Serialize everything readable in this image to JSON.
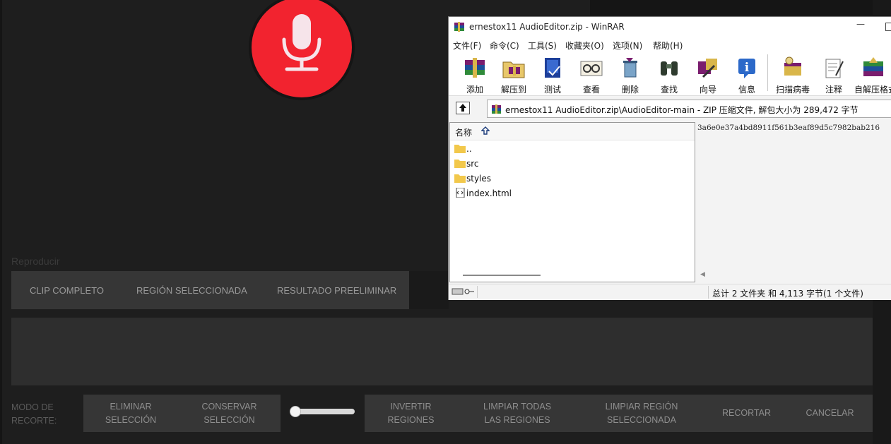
{
  "editor": {
    "reproducir_label": "Reproducir",
    "play_tabs": [
      "CLIP COMPLETO",
      "REGIÓN SELECCIONADA",
      "RESULTADO PREELIMINAR"
    ],
    "modo_label": [
      "MODO DE",
      "RECORTE:"
    ],
    "group1": [
      {
        "line1": "ELIMINAR",
        "line2": "SELECCIÓN"
      },
      {
        "line1": "CONSERVAR",
        "line2": "SELECCIÓN"
      }
    ],
    "group2": [
      {
        "line1": "INVERTIR",
        "line2": "REGIONES"
      },
      {
        "line1": "LIMPIAR TODAS",
        "line2": "LAS REGIONES"
      },
      {
        "line1": "LIMPIAR REGIÓN",
        "line2": "SELECCIONADA"
      },
      {
        "line1": "RECORTAR",
        "line2": ""
      },
      {
        "line1": "CANCELAR",
        "line2": ""
      }
    ],
    "slider_value": 0,
    "colors": {
      "mic": "#f2232f",
      "panel": "#363636",
      "background": "#1e1e1e"
    }
  },
  "winrar": {
    "title": "ernestox11 AudioEditor.zip - WinRAR",
    "menu": [
      "文件(F)",
      "命令(C)",
      "工具(S)",
      "收藏夹(O)",
      "选项(N)",
      "帮助(H)"
    ],
    "toolbar": [
      "添加",
      "解压到",
      "测试",
      "查看",
      "删除",
      "查找",
      "向导",
      "信息",
      "扫描病毒",
      "注释",
      "自解压格式"
    ],
    "address": "ernestox11 AudioEditor.zip\\AudioEditor-main - ZIP 压缩文件, 解包大小为 289,472 字节",
    "column_name": "名称",
    "files": [
      {
        "name": "..",
        "type": "folder"
      },
      {
        "name": "src",
        "type": "folder"
      },
      {
        "name": "styles",
        "type": "folder"
      },
      {
        "name": "index.html",
        "type": "file"
      }
    ],
    "preview_hash": "3a6e0e37a4bd8911f561b3eaf89d5c7982bab216",
    "status": "总计 2 文件夹 和 4,113 字节(1 个文件)"
  }
}
